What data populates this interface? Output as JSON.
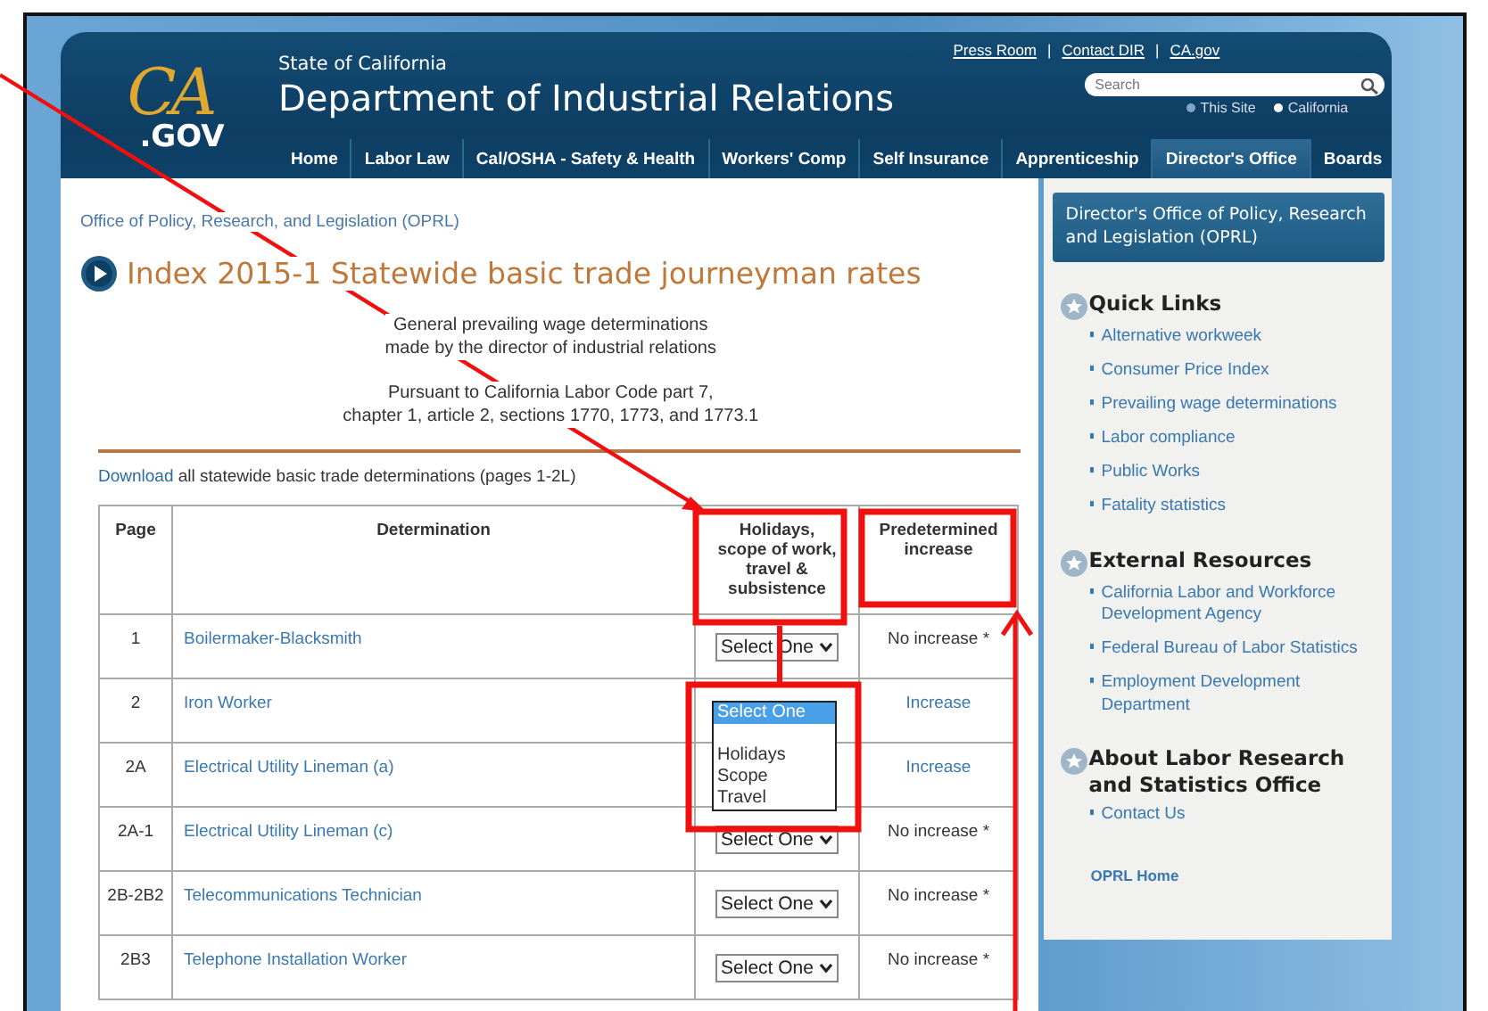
{
  "header": {
    "logo_top": "CA",
    "logo_bottom": ".GOV",
    "state_label": "State of California",
    "department": "Department of Industrial Relations",
    "top_links": [
      "Press Room",
      "Contact DIR",
      "CA.gov"
    ],
    "separator": "|",
    "search": {
      "placeholder": "Search"
    },
    "search_scope": [
      {
        "label": "This Site",
        "selected": false
      },
      {
        "label": "California",
        "selected": true
      }
    ],
    "nav": [
      {
        "label": "Home",
        "selected": false
      },
      {
        "label": "Labor Law",
        "selected": false
      },
      {
        "label": "Cal/OSHA - Safety & Health",
        "selected": false
      },
      {
        "label": "Workers' Comp",
        "selected": false
      },
      {
        "label": "Self Insurance",
        "selected": false
      },
      {
        "label": "Apprenticeship",
        "selected": false
      },
      {
        "label": "Director's Office",
        "selected": true
      },
      {
        "label": "Boards",
        "selected": false
      }
    ]
  },
  "main": {
    "breadcrumb": "Office of Policy, Research, and Legislation (OPRL)",
    "title": "Index 2015-1 Statewide basic trade journeyman rates",
    "intro": [
      "General prevailing wage determinations\nmade by the director of industrial relations",
      "Pursuant to California Labor Code part 7,\nchapter 1, article 2, sections 1770, 1773, and 1773.1"
    ],
    "download": {
      "link": "Download",
      "text": "all statewide basic trade determinations (pages 1-2L)"
    },
    "table": {
      "columns": [
        "Page",
        "Determination",
        "Holidays, scope of work, travel & subsistence",
        "Predetermined increase"
      ],
      "rows": [
        {
          "page": "1",
          "determination": "Boilermaker-Blacksmith",
          "select": "Select One",
          "increase": {
            "kind": "text",
            "text": "No increase *"
          }
        },
        {
          "page": "2",
          "determination": "Iron Worker",
          "dropdown": {
            "options": [
              {
                "label": "Select One",
                "selected": true
              },
              {
                "selected": false
              },
              {
                "label": "Holidays",
                "selected": false
              },
              {
                "label": "Scope",
                "selected": false
              },
              {
                "label": "Travel",
                "selected": false
              }
            ]
          },
          "increase": {
            "kind": "link",
            "text": "Increase"
          }
        },
        {
          "page": "2A",
          "determination": "Electrical Utility Lineman (a)",
          "increase": {
            "kind": "link",
            "text": "Increase"
          }
        },
        {
          "page": "2A-1",
          "determination": "Electrical Utility Lineman (c)",
          "select": "Select One",
          "increase": {
            "kind": "text",
            "text": "No increase *"
          }
        },
        {
          "page": "2B-2B2",
          "determination": "Telecommunications Technician",
          "select": "Select One",
          "increase": {
            "kind": "text",
            "text": "No increase *"
          }
        },
        {
          "page": "2B3",
          "determination": "Telephone Installation Worker",
          "select": "Select One",
          "increase": {
            "kind": "text",
            "text": "No increase *"
          }
        }
      ]
    }
  },
  "sidebar": {
    "heading": "Director's Office of Policy, Research and Legislation (OPRL)",
    "sections": [
      {
        "title": "Quick Links",
        "links": [
          "Alternative workweek",
          "Consumer Price Index",
          "Prevailing wage determinations",
          "Labor compliance",
          "Public Works",
          "Fatality statistics"
        ]
      },
      {
        "title": "External Resources",
        "links": [
          "California Labor and Workforce Development Agency",
          "Federal Bureau of Labor Statistics",
          "Employment Development Department"
        ]
      },
      {
        "title": "About Labor Research and Statistics Office",
        "links": [
          "Contact Us"
        ]
      }
    ],
    "footer_link": "OPRL Home"
  }
}
